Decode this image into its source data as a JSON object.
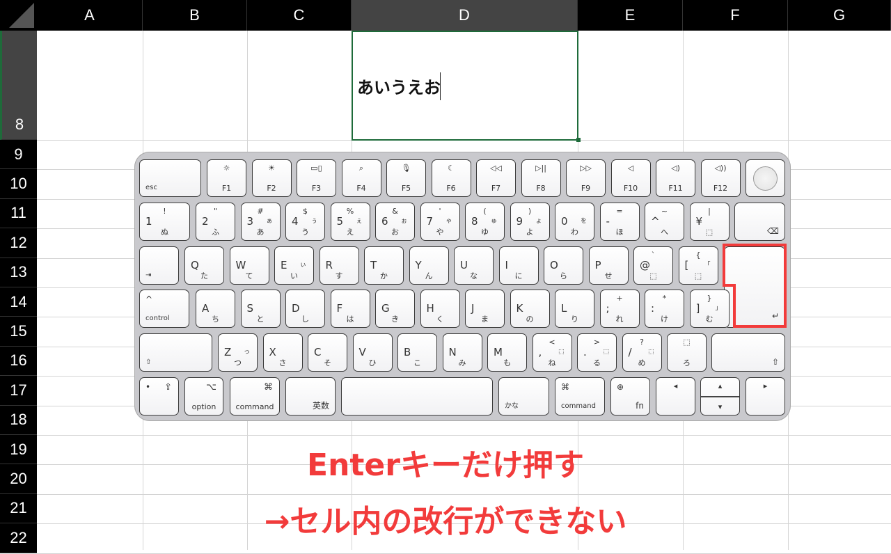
{
  "sheet": {
    "columns": [
      "A",
      "B",
      "C",
      "D",
      "E",
      "F",
      "G"
    ],
    "selected_column": "D",
    "rows": [
      "8",
      "9",
      "10",
      "11",
      "12",
      "13",
      "14",
      "15",
      "16",
      "17",
      "18",
      "19",
      "20",
      "21",
      "22"
    ],
    "selected_row": "8",
    "active_cell_text": "あいうえお",
    "accent_color": "#1e6b3a"
  },
  "keyboard": {
    "highlight_key": "enter",
    "highlight_color": "#f23b3b",
    "rows": [
      [
        {
          "bl": "esc"
        },
        {
          "t": "☼",
          "b": "F1"
        },
        {
          "t": "☀",
          "b": "F2"
        },
        {
          "t": "▭▯",
          "b": "F3"
        },
        {
          "t": "⌕",
          "b": "F4"
        },
        {
          "t": "🎙",
          "b": "F5"
        },
        {
          "t": "☾",
          "b": "F6"
        },
        {
          "t": "◁◁",
          "b": "F7"
        },
        {
          "t": "▷||",
          "b": "F8"
        },
        {
          "t": "▷▷",
          "b": "F9"
        },
        {
          "t": "◁",
          "b": "F10"
        },
        {
          "t": "◁)",
          "b": "F11"
        },
        {
          "t": "◁))",
          "b": "F12"
        },
        {
          "touch": "touch-id"
        }
      ],
      [
        {
          "t": "!",
          "l": "1",
          "b": "ぬ"
        },
        {
          "t": "\"",
          "l": "2",
          "b": "ふ"
        },
        {
          "t": "#",
          "l": "3",
          "r": "ぁ",
          "b": "あ"
        },
        {
          "t": "$",
          "l": "4",
          "r": "ぅ",
          "b": "う"
        },
        {
          "t": "%",
          "l": "5",
          "r": "ぇ",
          "b": "え"
        },
        {
          "t": "&",
          "l": "6",
          "r": "ぉ",
          "b": "お"
        },
        {
          "t": "'",
          "l": "7",
          "r": "ゃ",
          "b": "や"
        },
        {
          "t": "(",
          "l": "8",
          "r": "ゅ",
          "b": "ゆ"
        },
        {
          "t": ")",
          "l": "9",
          "r": "ょ",
          "b": "よ"
        },
        {
          "l": "0",
          "r": "を",
          "b": "わ"
        },
        {
          "t": "=",
          "l": "-",
          "b": "ほ"
        },
        {
          "t": "~",
          "l": "^",
          "b": "へ"
        },
        {
          "t": "|",
          "l": "¥",
          "b": "⬚"
        },
        {
          "br": "⌫"
        }
      ],
      [
        {
          "bl": "⇥"
        },
        {
          "l": "Q",
          "b": "た"
        },
        {
          "l": "W",
          "b": "て"
        },
        {
          "l": "E",
          "r": "ぃ",
          "b": "い"
        },
        {
          "l": "R",
          "b": "す"
        },
        {
          "l": "T",
          "b": "か"
        },
        {
          "l": "Y",
          "b": "ん"
        },
        {
          "l": "U",
          "b": "な"
        },
        {
          "l": "I",
          "b": "に"
        },
        {
          "l": "O",
          "b": "ら"
        },
        {
          "l": "P",
          "b": "せ"
        },
        {
          "t": "`",
          "l": "@",
          "b": "⬚"
        },
        {
          "t": "{",
          "l": "[",
          "r": "「",
          "b": "⬚"
        },
        {
          "br": ""
        }
      ],
      [
        {
          "tl": "^",
          "bl": "control"
        },
        {
          "l": "A",
          "b": "ち"
        },
        {
          "l": "S",
          "b": "と"
        },
        {
          "l": "D",
          "b": "し"
        },
        {
          "l": "F",
          "b": "は"
        },
        {
          "l": "G",
          "b": "き"
        },
        {
          "l": "H",
          "b": "く"
        },
        {
          "l": "J",
          "b": "ま"
        },
        {
          "l": "K",
          "b": "の"
        },
        {
          "l": "L",
          "b": "り"
        },
        {
          "t": "+",
          "l": ";",
          "b": "れ"
        },
        {
          "t": "*",
          "l": ":",
          "b": "け"
        },
        {
          "t": "}",
          "l": "]",
          "r": "」",
          "b": "む"
        },
        {
          "br": "↵"
        }
      ],
      [
        {
          "bl": "⇧"
        },
        {
          "l": "Z",
          "r": "っ",
          "b": "つ"
        },
        {
          "l": "X",
          "b": "さ"
        },
        {
          "l": "C",
          "b": "そ"
        },
        {
          "l": "V",
          "b": "ひ"
        },
        {
          "l": "B",
          "b": "こ"
        },
        {
          "l": "N",
          "b": "み"
        },
        {
          "l": "M",
          "b": "も"
        },
        {
          "t": "<",
          "l": ",",
          "r": "⬚",
          "b": "ね"
        },
        {
          "t": ">",
          "l": ".",
          "r": "⬚",
          "b": "る"
        },
        {
          "t": "?",
          "l": "/",
          "r": "⬚",
          "b": "め"
        },
        {
          "t": "⬚",
          "b": "ろ"
        },
        {
          "br": "⇧"
        }
      ],
      [
        {
          "tl": "•",
          "tr": "⇪"
        },
        {
          "tr": "⌥",
          "b": "option"
        },
        {
          "tr": "⌘",
          "b": "command"
        },
        {
          "br": "英数"
        },
        {},
        {
          "bl": "かな"
        },
        {
          "tl": "⌘",
          "bl": "command"
        },
        {
          "tl": "⊕",
          "br": "fn"
        },
        {
          "t": "◂"
        },
        {
          "t": "▴",
          "b": "▾"
        },
        {
          "t": "▸"
        }
      ]
    ]
  },
  "caption": {
    "line1": "Enterキーだけ押す",
    "line2": "→セル内の改行ができない",
    "color": "#f23b3b"
  }
}
